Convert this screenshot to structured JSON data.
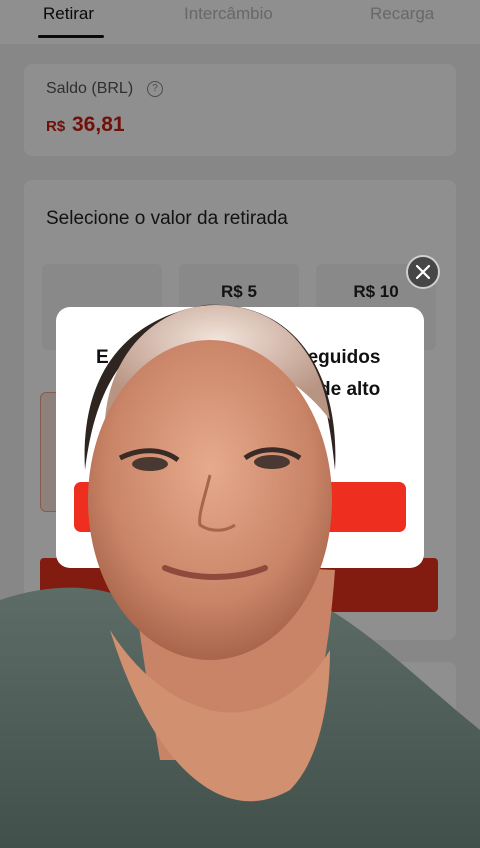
{
  "tabs": [
    {
      "label": "Retirar",
      "active": true
    },
    {
      "label": "Intercâmbio",
      "active": false
    },
    {
      "label": "Recarga",
      "active": false
    }
  ],
  "balance": {
    "label": "Saldo (BRL)",
    "help_icon": "question-circle-icon",
    "currency": "R$",
    "value": "36,81"
  },
  "withdraw": {
    "title": "Selecione o valor da retirada",
    "options": [
      {
        "label": ""
      },
      {
        "label": "R$ 5"
      },
      {
        "label": "R$ 10"
      }
    ]
  },
  "modal": {
    "text_line1_start": "E",
    "text_line1_end": "seguidos",
    "text_line2_end": "de alto",
    "close_icon": "close-icon"
  },
  "colors": {
    "accent": "#e8321e",
    "balance_value": "#c81e10"
  }
}
